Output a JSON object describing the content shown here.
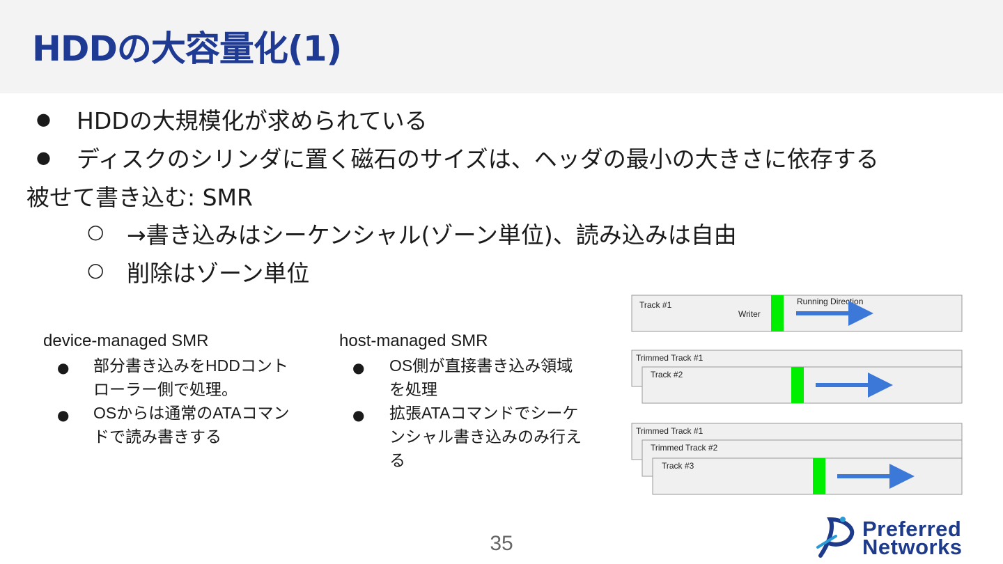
{
  "slide": {
    "title": "HDDの大容量化(1)",
    "bullets_l1": [
      "HDDの大規模化が求められている",
      "ディスクのシリンダに置く磁石のサイズは、ヘッダの最小の大きさに依存する"
    ],
    "plain_line": "被せて書き込む: SMR",
    "bullets_l2": [
      "→書き込みはシーケンシャル(ゾーン単位)、読み込みは自由",
      "削除はゾーン単位"
    ],
    "bullet_dot": "●",
    "sub_bullet": "○",
    "page_number": "35"
  },
  "columns": [
    {
      "heading": "device-managed SMR",
      "items": [
        "部分書き込みをHDDコントローラー側で処理。",
        "OSからは通常のATAコマンドで読み書きする"
      ]
    },
    {
      "heading": "host-managed SMR",
      "items": [
        "OS側が直接書き込み領域を処理",
        "拡張ATAコマンドでシーケンシャル書き込みのみ行える"
      ]
    }
  ],
  "diagram": {
    "panel1": {
      "track": "Track #1",
      "writer": "Writer",
      "direction": "Running Direction"
    },
    "panel2": {
      "trimmed1": "Trimmed Track #1",
      "track": "Track #2"
    },
    "panel3": {
      "trimmed1": "Trimmed Track #1",
      "trimmed2": "Trimmed Track #2",
      "track": "Track #3"
    },
    "colors": {
      "writer": "#00ee00",
      "arrow": "#3c78d8",
      "track_fill": "#f0f0f0",
      "track_border": "#999999"
    }
  },
  "logo": {
    "line1": "Preferred",
    "line2": "Networks",
    "color": "#1e3a8a"
  }
}
